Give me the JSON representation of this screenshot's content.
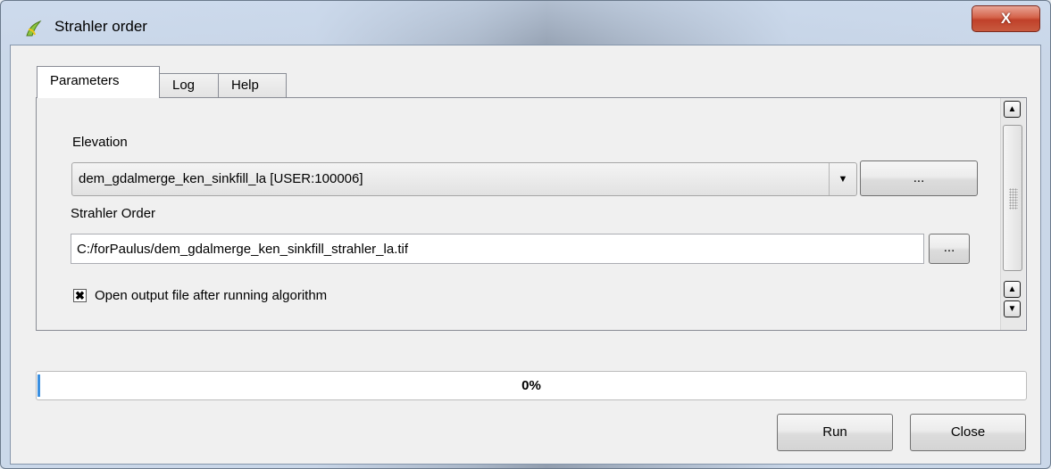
{
  "window": {
    "title": "Strahler order",
    "close_glyph": "X",
    "app_icon": "qgis-logo-icon"
  },
  "tabs": [
    {
      "label": "Parameters",
      "active": true
    },
    {
      "label": "Log",
      "active": false
    },
    {
      "label": "Help",
      "active": false
    }
  ],
  "parameters": {
    "elevation_label": "Elevation",
    "elevation_value": "dem_gdalmerge_ken_sinkfill_la [USER:100006]",
    "elevation_browse_label": "...",
    "strahler_label": "Strahler Order",
    "strahler_value": "C:/forPaulus/dem_gdalmerge_ken_sinkfill_strahler_la.tif",
    "strahler_browse_label": "...",
    "open_output_label": "Open output file after running algorithm",
    "open_output_checked": true
  },
  "progress": {
    "value": 0,
    "text": "0%",
    "fill_color": "#3a8fe0"
  },
  "buttons": {
    "run_label": "Run",
    "close_label": "Close"
  },
  "colors": {
    "close_button": "#c85a3f"
  }
}
